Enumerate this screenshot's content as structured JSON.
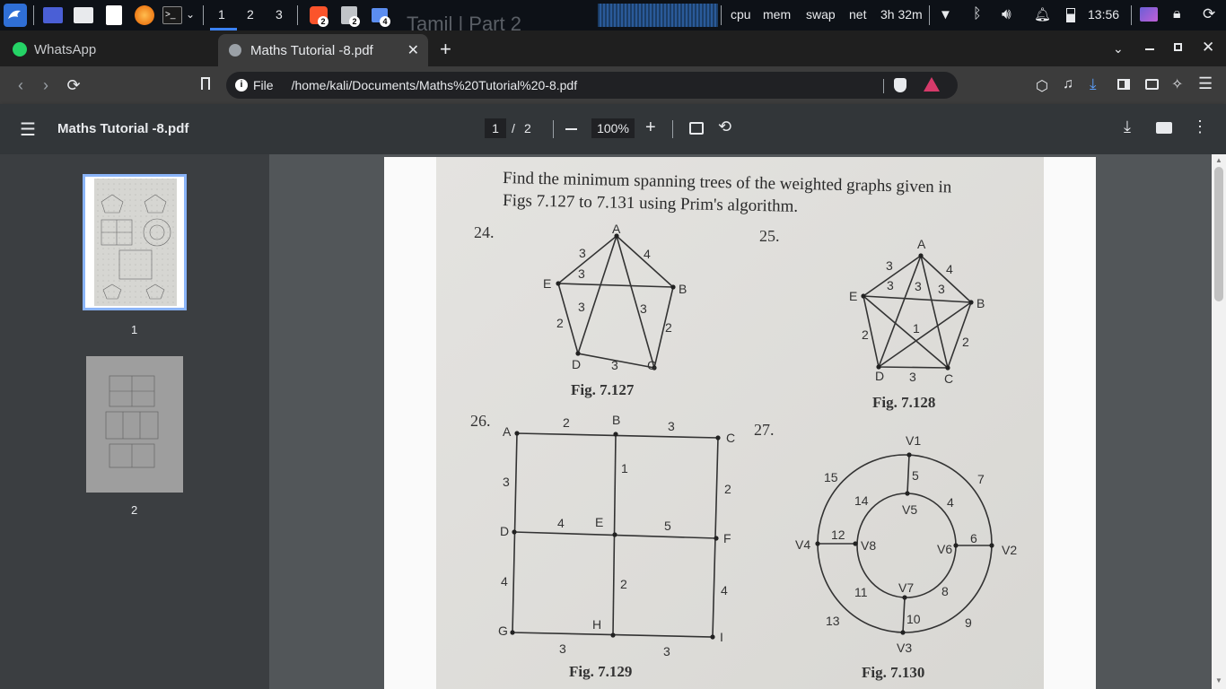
{
  "taskbar": {
    "workspaces": [
      "1",
      "2",
      "3"
    ],
    "brave_badge": "2",
    "files_badge": "2",
    "shield_badge": "4",
    "monitors": [
      "cpu",
      "mem",
      "swap",
      "net"
    ],
    "battery_time": "3h 32m",
    "clock": "13:56",
    "background_title": "Tamil | Part 2"
  },
  "tabs": {
    "pinned_label": "WhatsApp",
    "active_label": "Maths Tutorial -8.pdf",
    "new_tab": "+"
  },
  "address": {
    "scheme_label": "File",
    "url": "/home/kali/Documents/Maths%20Tutorial%20-8.pdf"
  },
  "pdf_toolbar": {
    "title": "Maths Tutorial -8.pdf",
    "page_current": "1",
    "page_separator": "/",
    "page_total": "2",
    "zoom": "100%"
  },
  "thumbnails": [
    {
      "label": "1",
      "selected": true
    },
    {
      "label": "2",
      "selected": false
    }
  ],
  "document": {
    "heading_line1": "Find the minimum spanning trees of the weighted graphs given in",
    "heading_line2": "Figs 7.127 to 7.131 using Prim's algorithm.",
    "problems": [
      "24.",
      "25.",
      "26.",
      "27."
    ],
    "figures": [
      "Fig. 7.127",
      "Fig. 7.128",
      "Fig. 7.129",
      "Fig. 7.130"
    ],
    "fig127": {
      "vertices": [
        "A",
        "B",
        "C",
        "D",
        "E"
      ],
      "weights": [
        "3",
        "4",
        "3",
        "3",
        "3",
        "2",
        "2",
        "3"
      ]
    },
    "fig128": {
      "vertices": [
        "A",
        "B",
        "C",
        "D",
        "E"
      ],
      "weights": [
        "3",
        "4",
        "3",
        "3",
        "3",
        "1",
        "2",
        "2",
        "3"
      ]
    },
    "fig129": {
      "vertices": [
        "A",
        "B",
        "C",
        "D",
        "E",
        "F",
        "G",
        "H",
        "I"
      ],
      "weights": [
        "2",
        "3",
        "3",
        "1",
        "2",
        "4",
        "5",
        "4",
        "2",
        "4",
        "3",
        "3"
      ]
    },
    "fig130": {
      "vertices": [
        "V1",
        "V2",
        "V3",
        "V4",
        "V5",
        "V6",
        "V7",
        "V8"
      ],
      "weights": [
        "15",
        "5",
        "7",
        "14",
        "4",
        "12",
        "6",
        "11",
        "8",
        "13",
        "10",
        "9"
      ]
    }
  }
}
